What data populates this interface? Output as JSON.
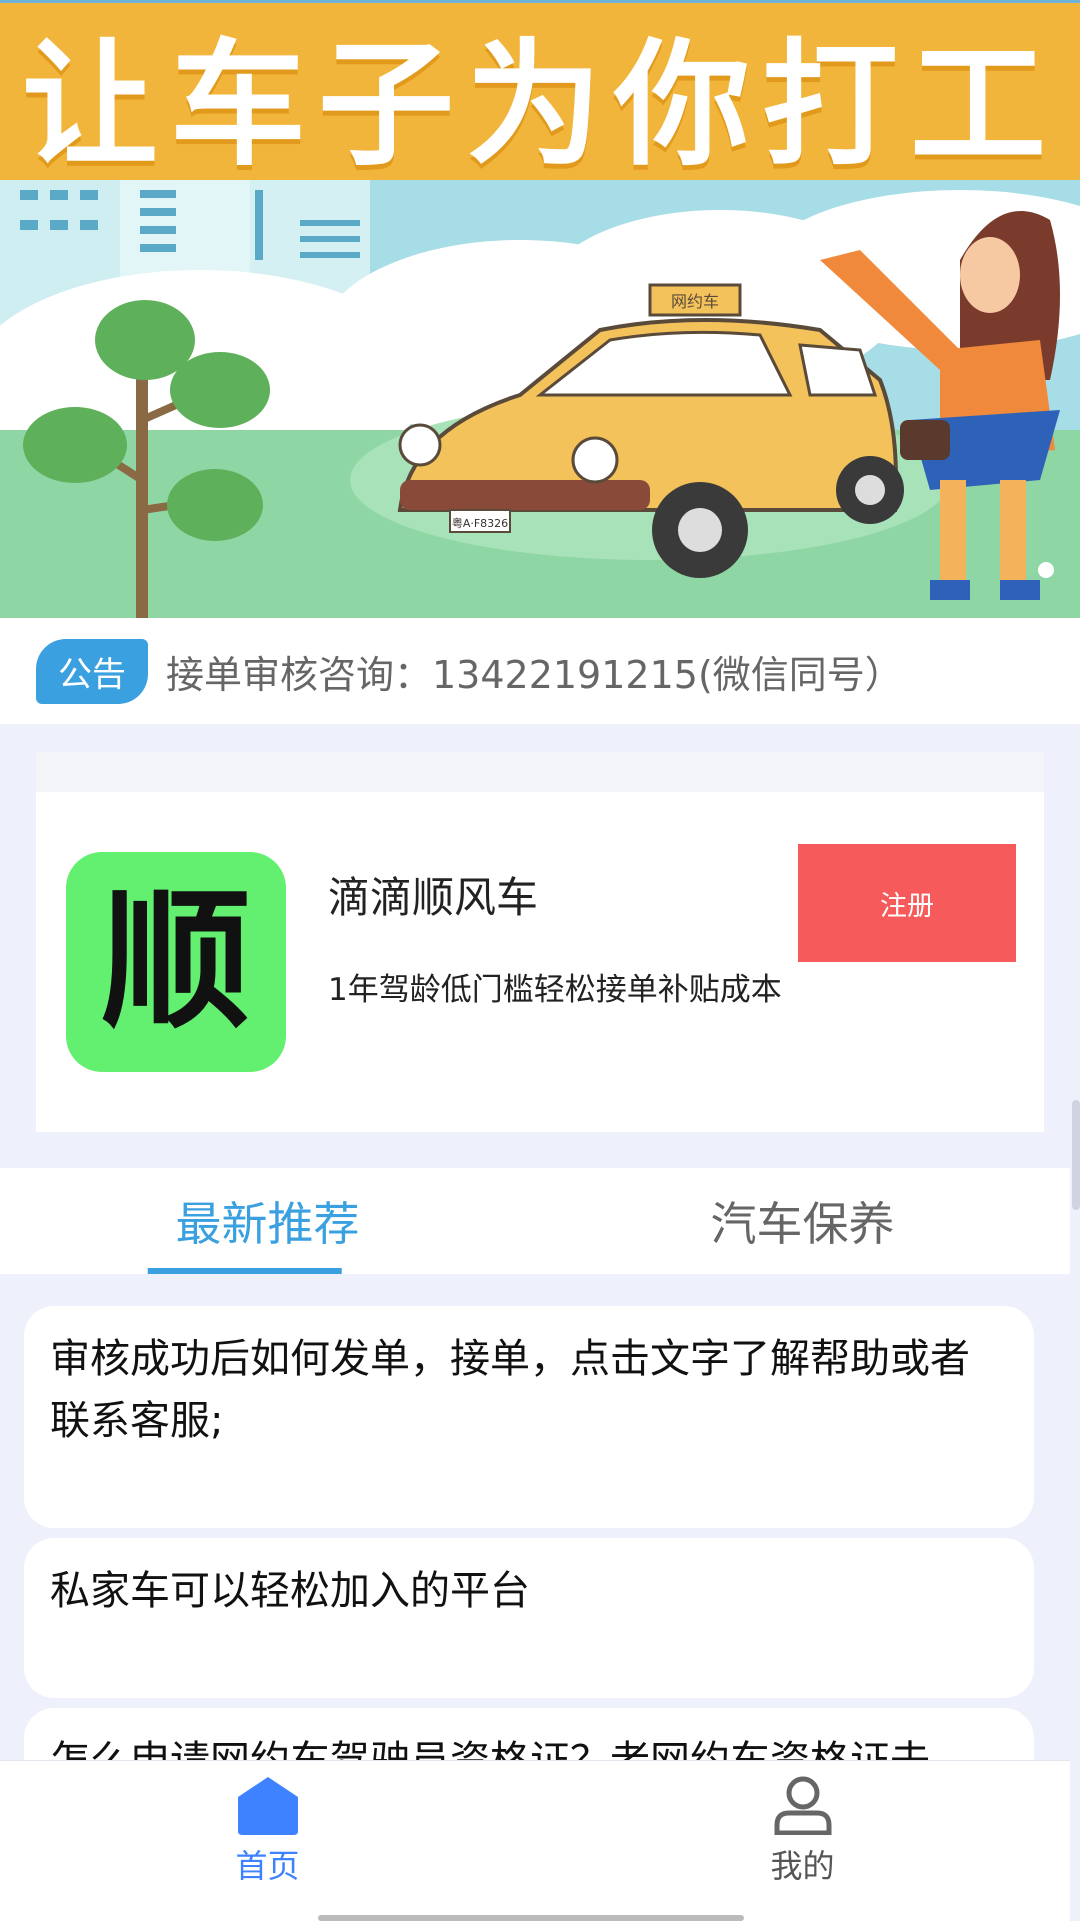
{
  "banner": {
    "headline": "让车子为你打工",
    "sign_text": "网约车",
    "plate_text": "粤A·F8326"
  },
  "notice": {
    "badge": "公告",
    "text": "接单审核咨询：13422191215(微信同号）"
  },
  "partner_card": {
    "icon_char": "顺",
    "title": "滴滴顺风车",
    "description": "1年驾龄低门槛轻松接单补贴成本",
    "register_label": "注册"
  },
  "tabs": [
    {
      "label": "最新推荐",
      "active": true
    },
    {
      "label": "汽车保养",
      "active": false
    }
  ],
  "articles": [
    "审核成功后如何发单，接单，点击文字了解帮助或者联系客服;",
    "私家车可以轻松加入的平台",
    "怎么申请网约车驾驶员资格证？老网约车资格证去"
  ],
  "bottom_nav": [
    {
      "label": "首页",
      "icon": "home-icon",
      "active": true
    },
    {
      "label": "我的",
      "icon": "user-icon",
      "active": false
    }
  ],
  "colors": {
    "accent_blue": "#3aa0e0",
    "nav_blue": "#3f82ff",
    "register_red": "#f65a5a",
    "banner_yellow": "#f2b53b",
    "app_icon_green": "#63f070"
  }
}
